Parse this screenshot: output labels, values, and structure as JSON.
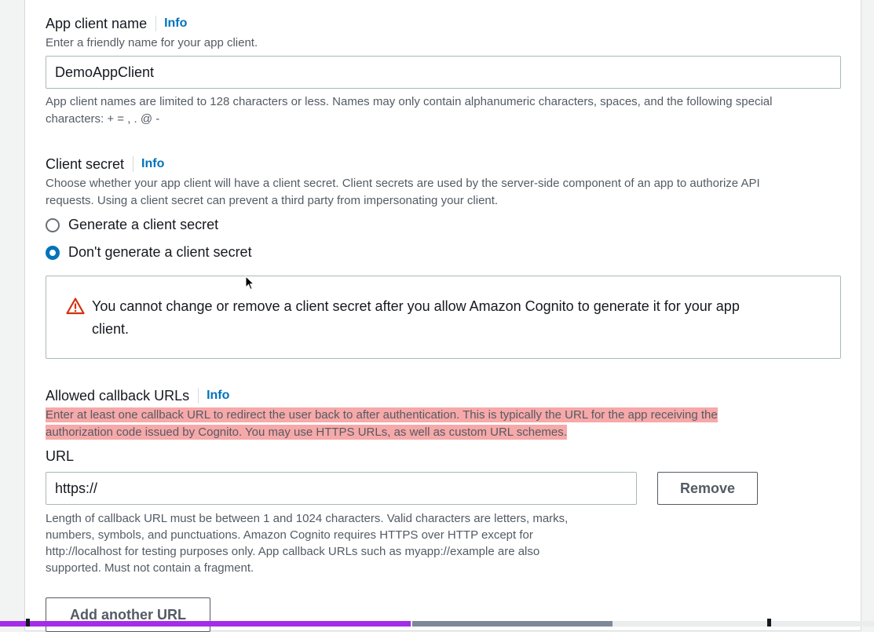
{
  "app_client_name": {
    "label": "App client name",
    "info_link": "Info",
    "description": "Enter a friendly name for your app client.",
    "value": "DemoAppClient",
    "constraint_line1": "App client names are limited to 128 characters or less. Names may only contain alphanumeric characters, spaces, and the following special",
    "constraint_line2": "characters: + = , . @ -"
  },
  "client_secret": {
    "label": "Client secret",
    "info_link": "Info",
    "description_line1": "Choose whether your app client will have a client secret. Client secrets are used by the server-side component of an app to authorize API",
    "description_line2": "requests. Using a client secret can prevent a third party from impersonating your client.",
    "options": [
      {
        "label": "Generate a client secret",
        "selected": false
      },
      {
        "label": "Don't generate a client secret",
        "selected": true
      }
    ],
    "warning_line1": "You cannot change or remove a client secret after you allow Amazon Cognito to generate it for your app",
    "warning_line2": "client.",
    "warning_icon": "warning-triangle-icon"
  },
  "callback_urls": {
    "label": "Allowed callback URLs",
    "info_link": "Info",
    "description_line1": "Enter at least one callback URL to redirect the user back to after authentication. This is typically the URL for the app receiving the",
    "description_line2": "authorization code issued by Cognito. You may use HTTPS URLs, as well as custom URL schemes.",
    "url_label": "URL",
    "url_value": "https://",
    "remove_button": "Remove",
    "constraint_lines": [
      "Length of callback URL must be between 1 and 1024 characters. Valid characters are letters, marks,",
      "numbers, symbols, and punctuations. Amazon Cognito requires HTTPS over HTTP except for",
      "http://localhost for testing purposes only. App callback URLs such as myapp://example are also",
      "supported. Must not contain a fragment."
    ],
    "add_button": "Add another URL"
  },
  "colors": {
    "link": "#0073bb",
    "highlight": "#f7a8a8",
    "warning": "#d13212",
    "progress": "#a32de8"
  },
  "progress": {
    "fraction": 0.47
  }
}
